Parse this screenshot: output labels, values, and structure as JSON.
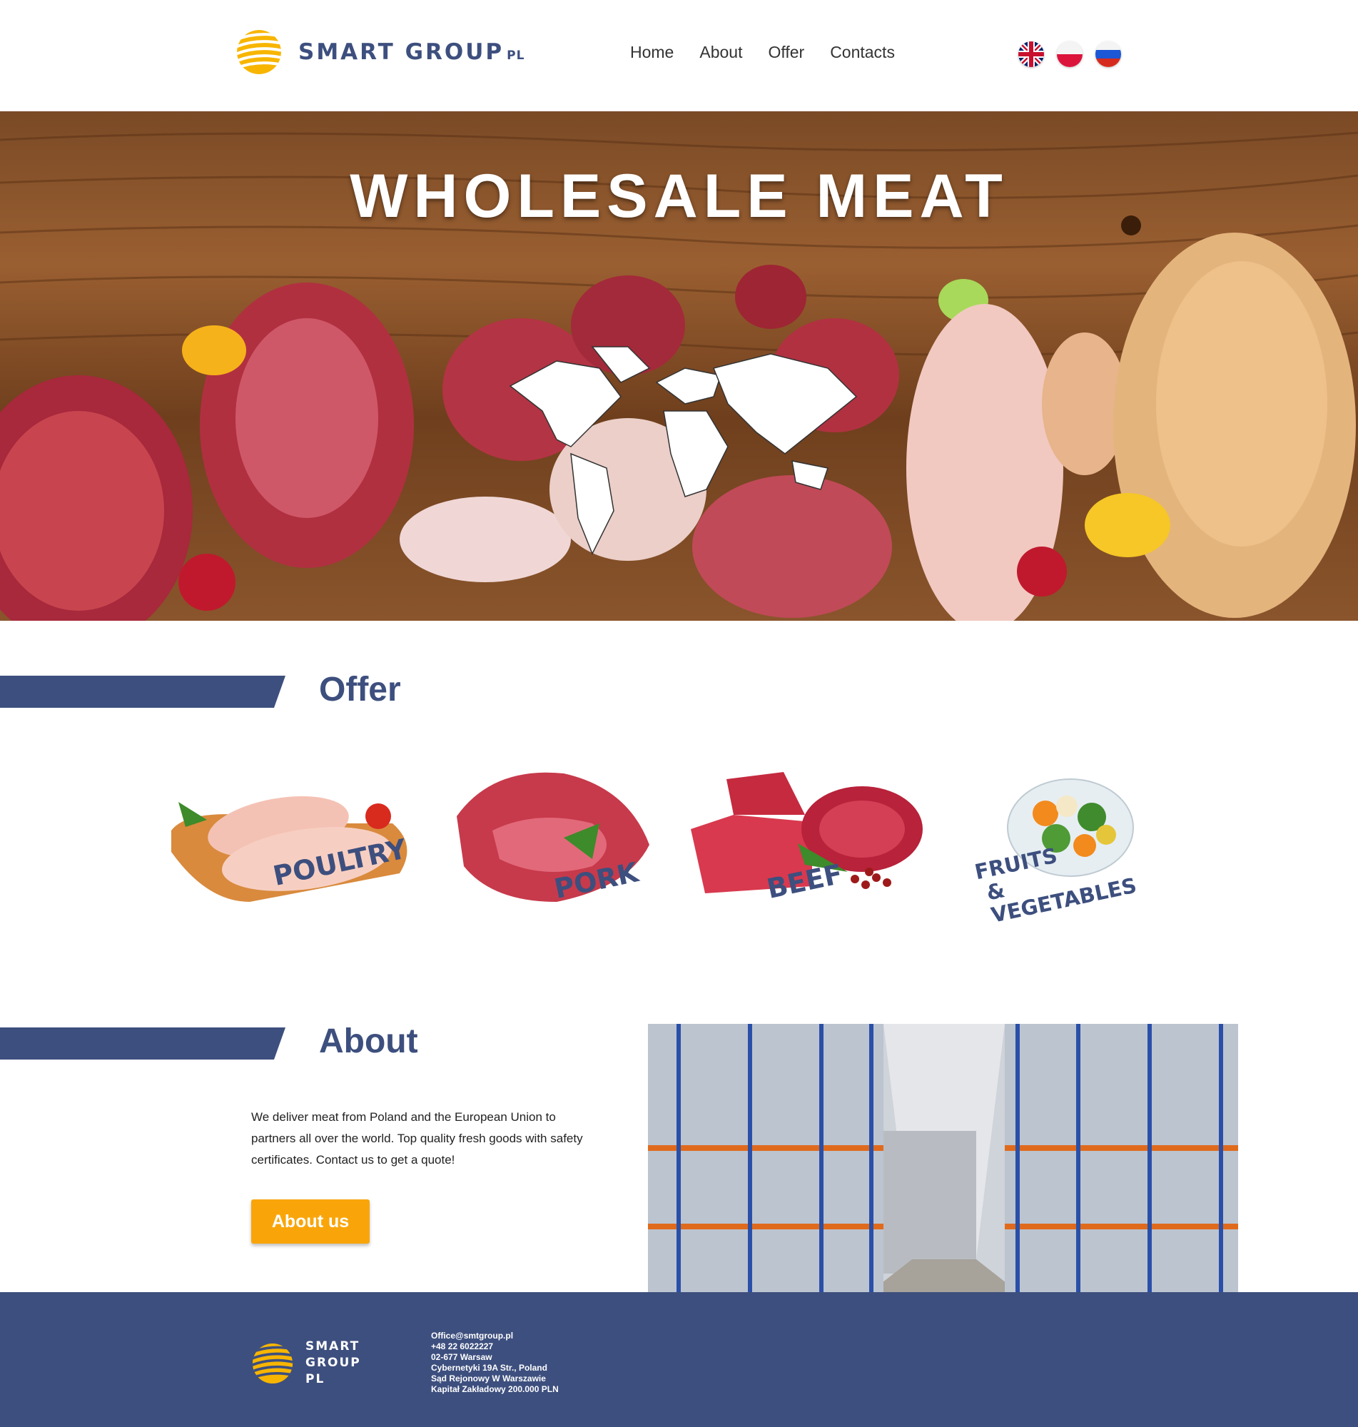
{
  "header": {
    "logo": {
      "name": "SMART GROUP",
      "suffix": "PL"
    },
    "nav": [
      {
        "label": "Home"
      },
      {
        "label": "About"
      },
      {
        "label": "Offer"
      },
      {
        "label": "Contacts"
      }
    ],
    "languages": [
      "english-flag",
      "polish-flag",
      "russian-flag"
    ]
  },
  "hero": {
    "title": "WHOLESALE MEAT"
  },
  "offer": {
    "title": "Offer",
    "items": [
      {
        "label": "POULTRY"
      },
      {
        "label": "PORK"
      },
      {
        "label": "BEEF"
      },
      {
        "label_line1": "FRUITS",
        "label_line2": "& VEGETABLES"
      }
    ]
  },
  "about": {
    "title": "About",
    "text": "We deliver meat from Poland and the European Union to partners all over the world. Top quality fresh goods with safety certificates. Contact us to get a quote!",
    "button": "About us"
  },
  "footer": {
    "logo_lines": [
      "SMART",
      "GROUP",
      "PL"
    ],
    "info": [
      "Office@smtgroup.pl",
      "+48 22 6022227",
      "02-677 Warsaw",
      "Cybernetyki 19A Str., Poland",
      "Sąd Rejonowy W Warszawie",
      "Kapitał Zakładowy 200.000 PLN"
    ]
  },
  "colors": {
    "brand_blue": "#3d4f7e",
    "accent_orange": "#f9a50a",
    "logo_yellow": "#f7b500"
  }
}
